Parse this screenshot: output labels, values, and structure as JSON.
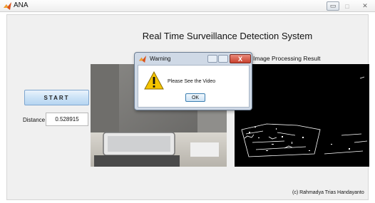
{
  "window": {
    "title": "ANA",
    "controls": {
      "minimize": "▭",
      "maximize": "□",
      "close": "✕"
    }
  },
  "main": {
    "system_title": "Real Time Surveillance Detection System",
    "start_label": "START",
    "distance_label": "Distance",
    "distance_value": "0.528915",
    "result_label": "Image Processing Result",
    "credit": "(c) Rahmadya Trias Handayanto"
  },
  "dialog": {
    "title": "Warning",
    "message": "Please See the Video",
    "ok_label": "OK",
    "close_glyph": "X"
  },
  "icons": {
    "app": "matlab-logo-icon",
    "warning": "warning-triangle-icon"
  },
  "colors": {
    "start_button": "#c9e1f6",
    "dialog_close": "#c8412d",
    "warning_yellow": "#f5c400"
  }
}
